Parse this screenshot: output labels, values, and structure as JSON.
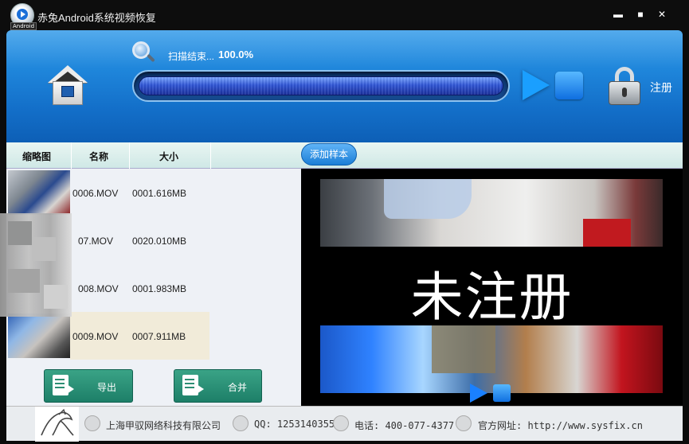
{
  "window": {
    "title": "赤兔Android系统视频恢复",
    "logo_tag": "Android",
    "minimize": "▬",
    "maximize": "■",
    "close": "✕"
  },
  "scan": {
    "status_text": "扫描结束...",
    "percent_text": "100.0%",
    "progress": 1.0
  },
  "header": {
    "register_label": "注册"
  },
  "columns": {
    "thumbnail": "缩略图",
    "name": "名称",
    "size": "大小",
    "add_sample": "添加样本"
  },
  "files": [
    {
      "name": "0006.MOV",
      "size": "0001.616MB",
      "selected": false
    },
    {
      "name": "07.MOV",
      "size": "0020.010MB",
      "selected": false
    },
    {
      "name": "008.MOV",
      "size": "0001.983MB",
      "selected": false
    },
    {
      "name": "0009.MOV",
      "size": "0007.911MB",
      "selected": true
    }
  ],
  "actions": {
    "export": "导出",
    "merge": "合并"
  },
  "preview": {
    "watermark": "未注册"
  },
  "footer": {
    "company": "上海甲驭网络科技有限公司",
    "qq": "QQ: 1253140355",
    "phone": "电话: 400-077-4377",
    "website": "官方网址: http://www.sysfix.cn"
  }
}
